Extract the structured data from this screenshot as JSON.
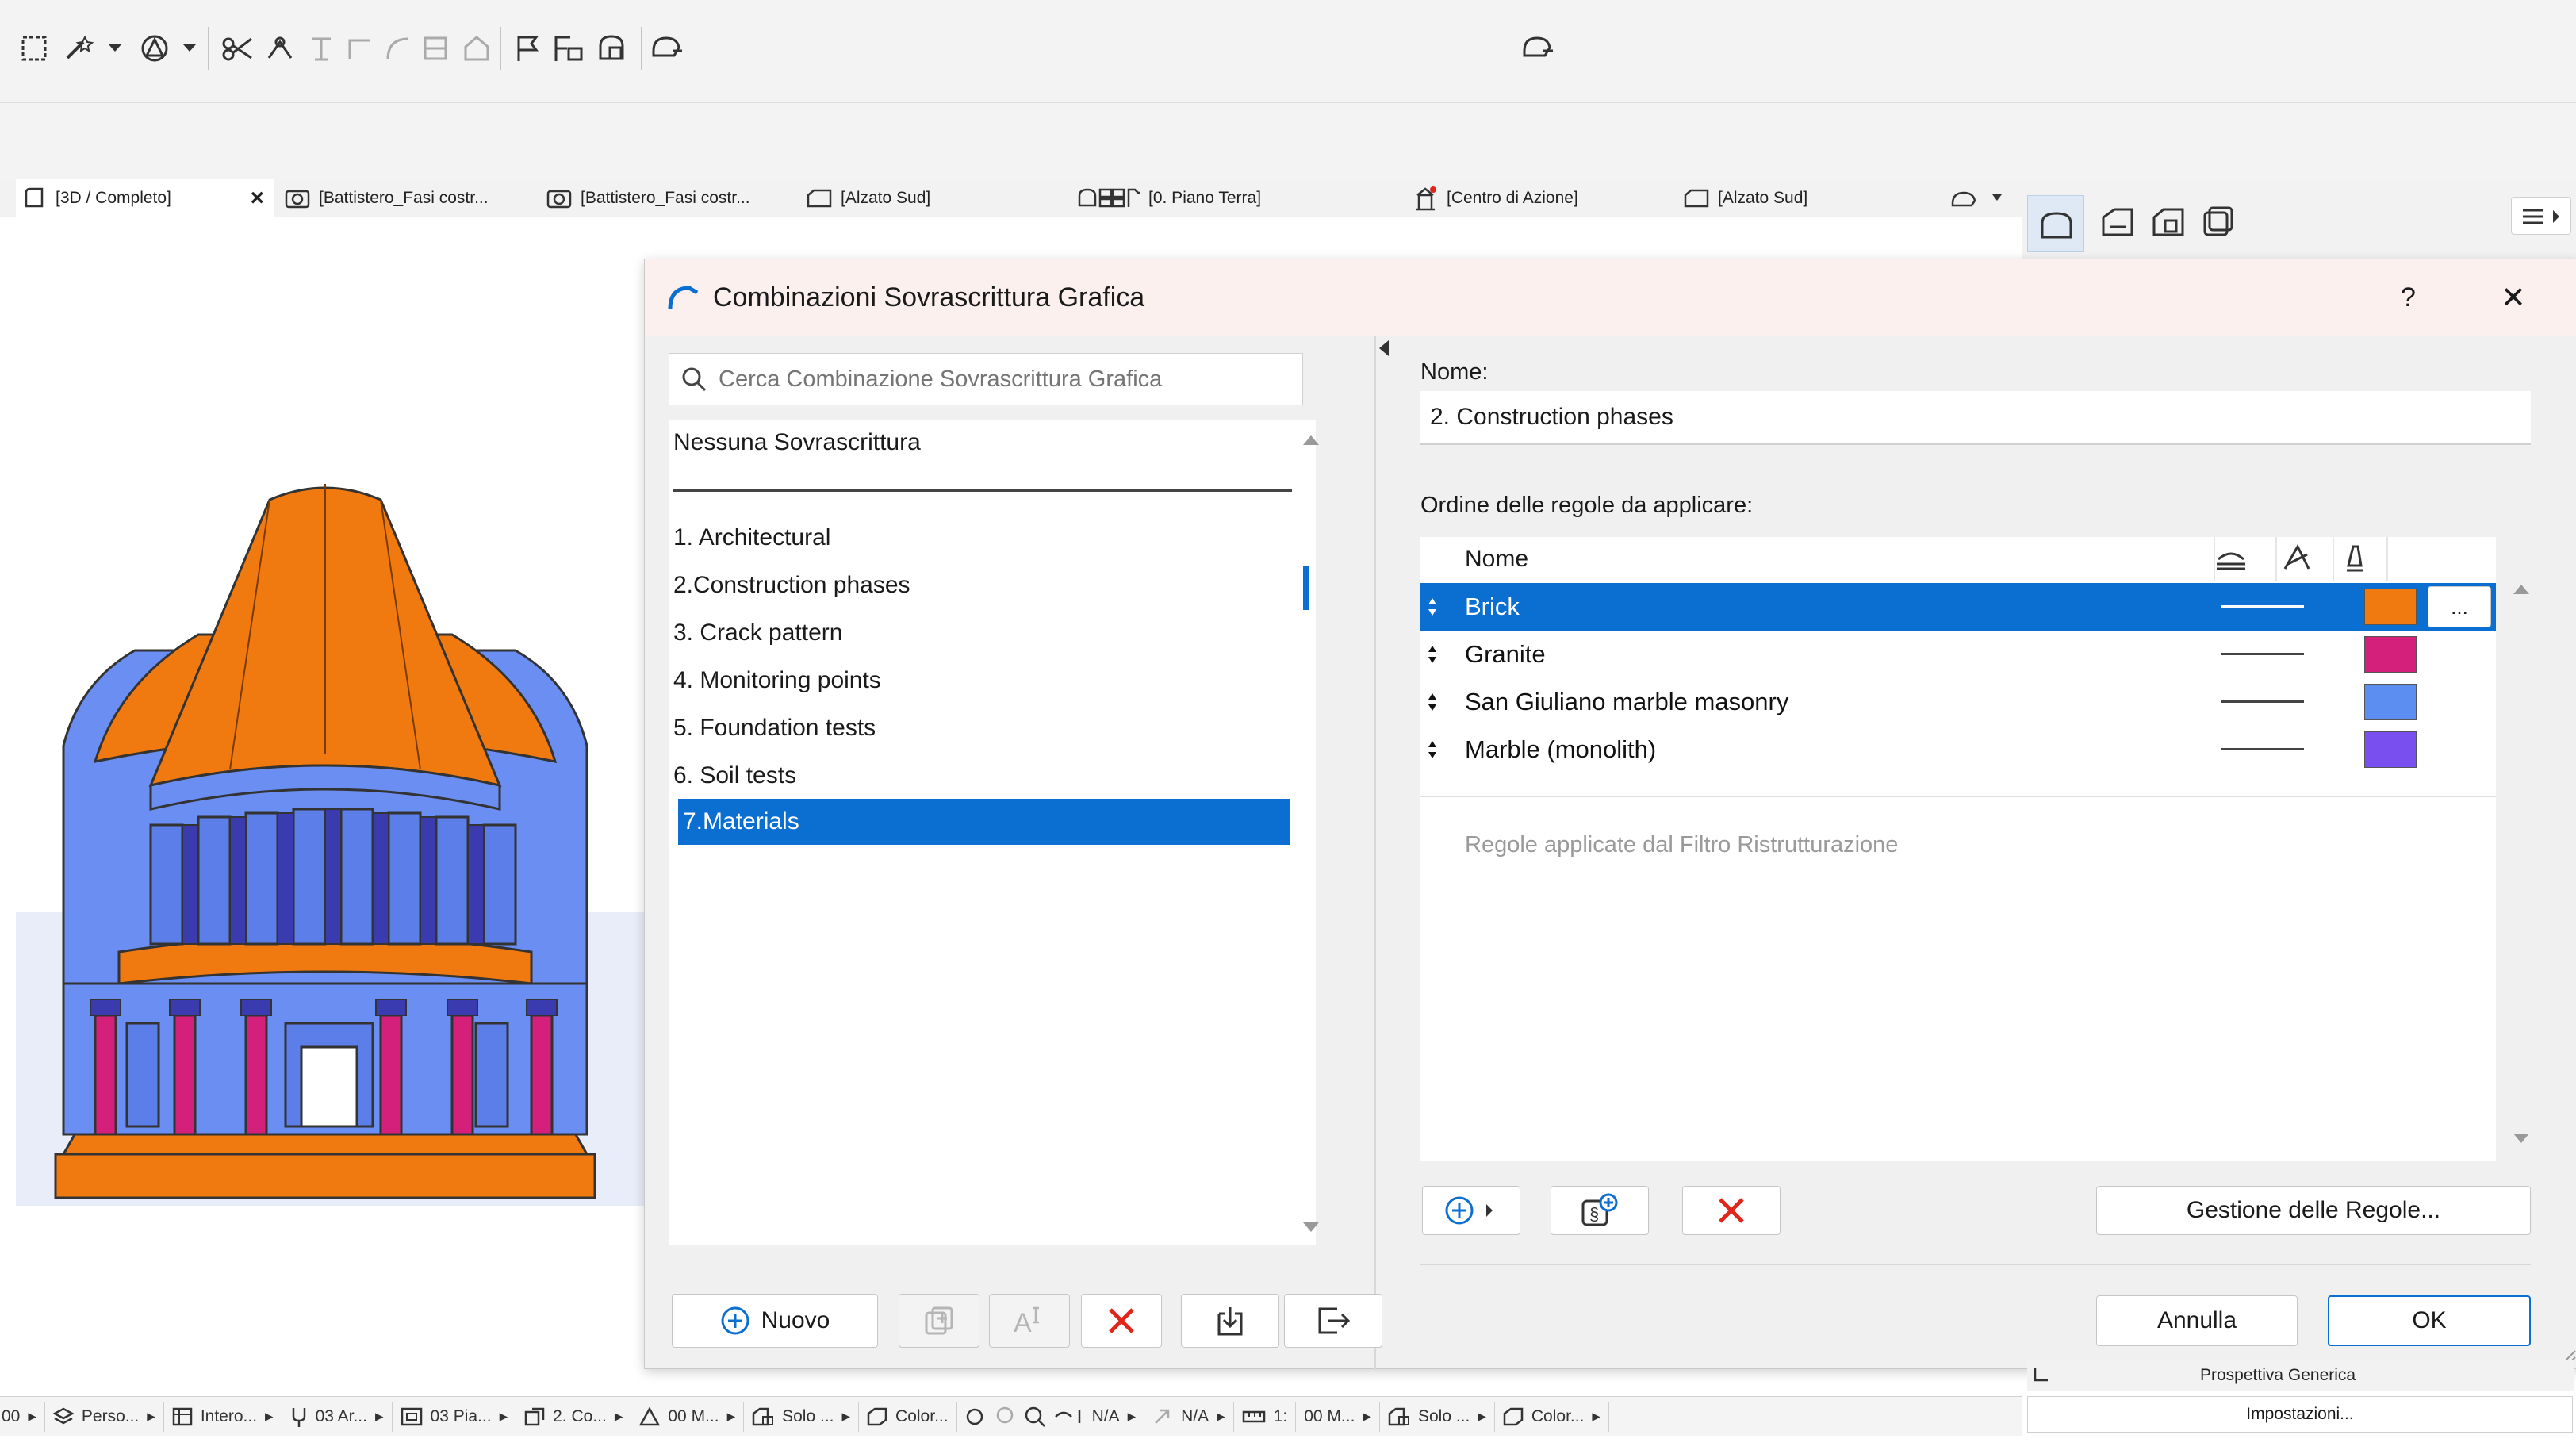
{
  "colors": {
    "accent": "#0a6fd1",
    "brick": "#f07a10",
    "granite": "#d4207a",
    "marble_masonry": "#5b8ef0",
    "marble_monolith": "#7a4ff0",
    "delete": "#e0261b"
  },
  "toolbar": {
    "icons": [
      "select-marquee-icon",
      "magic-wand-icon",
      "shapes-icon",
      "trim-icon",
      "split-icon",
      "offset-icon",
      "fillet-icon",
      "crop-icon",
      "roof-icon",
      "flag-icon",
      "schedule-icon",
      "renovation-icon",
      "model-view-icon"
    ],
    "center_icon": "model-view-icon"
  },
  "tabs": [
    {
      "label": "[3D / Completo]",
      "icon": "3d-window-icon"
    },
    {
      "label": "[Battistero_Fasi costr...",
      "icon": "camera-icon"
    },
    {
      "label": "[Battistero_Fasi costr...",
      "icon": "camera-icon"
    },
    {
      "label": "[Alzato Sud]",
      "icon": "elevation-icon"
    },
    {
      "label": "[0. Piano Terra]",
      "icon": "floor-plan-icon"
    },
    {
      "label": "[Centro di Azione]",
      "icon": "action-center-icon"
    },
    {
      "label": "[Alzato Sud]",
      "icon": "elevation-icon"
    }
  ],
  "tab_close": "×",
  "dialog": {
    "title": "Combinazioni Sovrascrittura Grafica",
    "help": "?",
    "close": "✕",
    "search_placeholder": "Cerca Combinazione Sovrascrittura Grafica",
    "none_item": "Nessuna Sovrascrittura",
    "combinations": [
      "1. Architectural",
      "2.Construction phases",
      "3. Crack pattern",
      "4. Monitoring points",
      "5. Foundation tests",
      "6. Soil tests",
      "7.Materials"
    ],
    "selected_index": 6,
    "new_button": "Nuovo",
    "name_label": "Nome:",
    "name_value": "2. Construction phases",
    "rules_order_label": "Ordine delle regole da applicare:",
    "rules_header": "Nome",
    "rules": [
      {
        "name": "Brick",
        "color": "#f07a10",
        "selected": true
      },
      {
        "name": "Granite",
        "color": "#d4207a",
        "selected": false
      },
      {
        "name": "San Giuliano marble masonry",
        "color": "#5b8ef0",
        "selected": false
      },
      {
        "name": "Marble (monolith)",
        "color": "#7a4ff0",
        "selected": false
      }
    ],
    "more_button": "...",
    "renovation_rules": "Regole applicate dal Filtro Ristrutturazione",
    "manage_rules_button": "Gestione delle Regole...",
    "cancel_button": "Annulla",
    "ok_button": "OK"
  },
  "right_panel": {
    "perspective_label": "Prospettiva Generica",
    "settings_button": "Impostazioni..."
  },
  "statusbar": [
    {
      "label": "Perso...",
      "icon": "layers-icon"
    },
    {
      "label": "Intero...",
      "icon": "model-filter-icon"
    },
    {
      "label": "03 Ar...",
      "icon": "pen-set-icon"
    },
    {
      "label": "03 Pia...",
      "icon": "model-view-options-icon"
    },
    {
      "label": "2. Co...",
      "icon": "graphic-override-icon"
    },
    {
      "label": "00 M...",
      "icon": "surface-icon"
    },
    {
      "label": "Solo ...",
      "icon": "renovation-filter-icon"
    },
    {
      "label": "Color...",
      "icon": "structural-icon"
    },
    {
      "label": "N/A",
      "icon": "zoom-icon"
    },
    {
      "label": "N/A",
      "icon": "orbit-icon"
    },
    {
      "label": "1:",
      "icon": "scale-icon"
    },
    {
      "label": "00 M...",
      "icon": "dimension-icon"
    },
    {
      "label": "Solo ...",
      "icon": "renovation-filter-icon"
    },
    {
      "label": "Color...",
      "icon": "structural-icon"
    }
  ],
  "statusbar_first": "00"
}
